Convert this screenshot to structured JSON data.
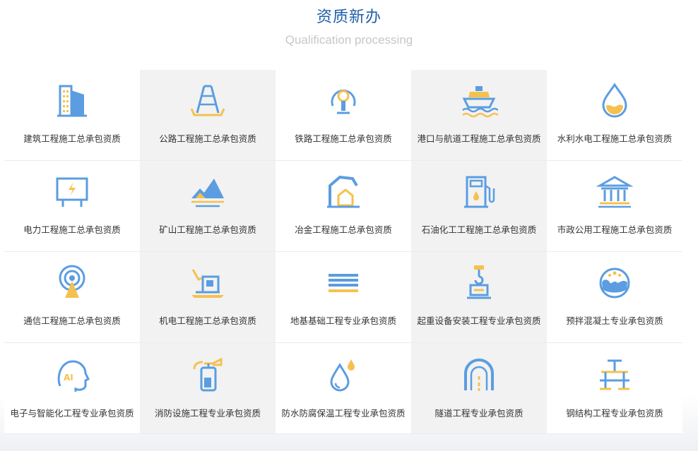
{
  "header": {
    "title": "资质新办",
    "subtitle": "Qualification processing"
  },
  "colors": {
    "blue": "#5b9de0",
    "yellow": "#f5c14e",
    "title": "#1f5fa8"
  },
  "items": [
    {
      "label": "建筑工程施工总承包资质",
      "icon": "building-icon"
    },
    {
      "label": "公路工程施工总承包资质",
      "icon": "highway-icon"
    },
    {
      "label": "铁路工程施工总承包资质",
      "icon": "railway-icon"
    },
    {
      "label": "港口与航道工程施工总承包资质",
      "icon": "ship-icon"
    },
    {
      "label": "水利水电工程施工总承包资质",
      "icon": "water-drop-icon"
    },
    {
      "label": "电力工程施工总承包资质",
      "icon": "electric-panel-icon"
    },
    {
      "label": "矿山工程施工总承包资质",
      "icon": "mountain-icon"
    },
    {
      "label": "冶金工程施工总承包资质",
      "icon": "furnace-icon"
    },
    {
      "label": "石油化工工程施工总承包资质",
      "icon": "fuel-pump-icon"
    },
    {
      "label": "市政公用工程施工总承包资质",
      "icon": "public-building-icon"
    },
    {
      "label": "通信工程施工总承包资质",
      "icon": "signal-tower-icon"
    },
    {
      "label": "机电工程施工总承包资质",
      "icon": "excavator-icon"
    },
    {
      "label": "地基基础工程专业承包资质",
      "icon": "foundation-layers-icon"
    },
    {
      "label": "起重设备安装工程专业承包资质",
      "icon": "crane-hook-icon"
    },
    {
      "label": "预拌混凝土专业承包资质",
      "icon": "concrete-icon"
    },
    {
      "label": "电子与智能化工程专业承包资质",
      "icon": "ai-head-icon"
    },
    {
      "label": "消防设施工程专业承包资质",
      "icon": "fire-extinguisher-icon"
    },
    {
      "label": "防水防腐保温工程专业承包资质",
      "icon": "waterproof-drop-icon"
    },
    {
      "label": "隧道工程专业承包资质",
      "icon": "tunnel-icon"
    },
    {
      "label": "钢结构工程专业承包资质",
      "icon": "steel-structure-icon"
    }
  ]
}
